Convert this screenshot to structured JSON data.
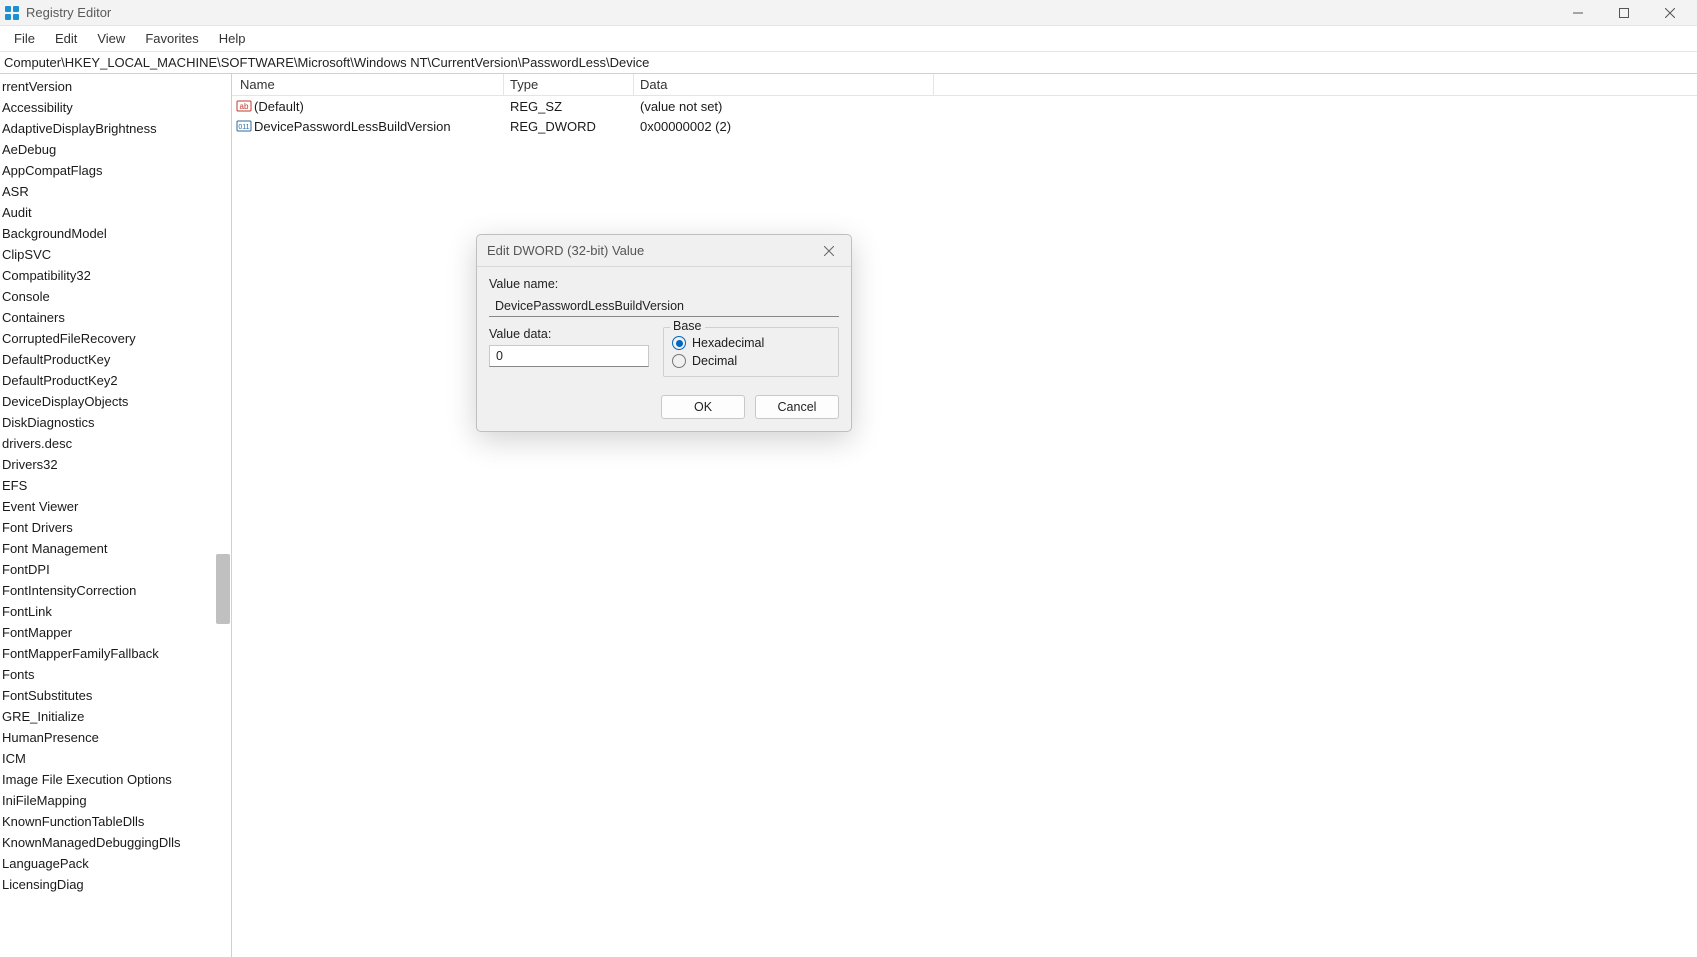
{
  "titlebar": {
    "app_title": "Registry Editor"
  },
  "menu": {
    "file": "File",
    "edit": "Edit",
    "view": "View",
    "favorites": "Favorites",
    "help": "Help"
  },
  "address": "Computer\\HKEY_LOCAL_MACHINE\\SOFTWARE\\Microsoft\\Windows NT\\CurrentVersion\\PasswordLess\\Device",
  "tree_items": [
    "rrentVersion",
    "Accessibility",
    "AdaptiveDisplayBrightness",
    "AeDebug",
    "AppCompatFlags",
    "ASR",
    "Audit",
    "BackgroundModel",
    "ClipSVC",
    "Compatibility32",
    "Console",
    "Containers",
    "CorruptedFileRecovery",
    "DefaultProductKey",
    "DefaultProductKey2",
    "DeviceDisplayObjects",
    "DiskDiagnostics",
    "drivers.desc",
    "Drivers32",
    "EFS",
    "Event Viewer",
    "Font Drivers",
    "Font Management",
    "FontDPI",
    "FontIntensityCorrection",
    "FontLink",
    "FontMapper",
    "FontMapperFamilyFallback",
    "Fonts",
    "FontSubstitutes",
    "GRE_Initialize",
    "HumanPresence",
    "ICM",
    "Image File Execution Options",
    "IniFileMapping",
    "KnownFunctionTableDlls",
    "KnownManagedDebuggingDlls",
    "LanguagePack",
    "LicensingDiag"
  ],
  "list": {
    "columns": {
      "name": "Name",
      "type": "Type",
      "data": "Data"
    },
    "rows": [
      {
        "icon": "string",
        "name": "(Default)",
        "type": "REG_SZ",
        "data": "(value not set)"
      },
      {
        "icon": "binary",
        "name": "DevicePasswordLessBuildVersion",
        "type": "REG_DWORD",
        "data": "0x00000002 (2)"
      }
    ]
  },
  "dialog": {
    "title": "Edit DWORD (32-bit) Value",
    "value_name_label": "Value name:",
    "value_name": "DevicePasswordLessBuildVersion",
    "value_data_label": "Value data:",
    "value_data": "0",
    "base_label": "Base",
    "hex_label": "Hexadecimal",
    "dec_label": "Decimal",
    "ok": "OK",
    "cancel": "Cancel"
  }
}
